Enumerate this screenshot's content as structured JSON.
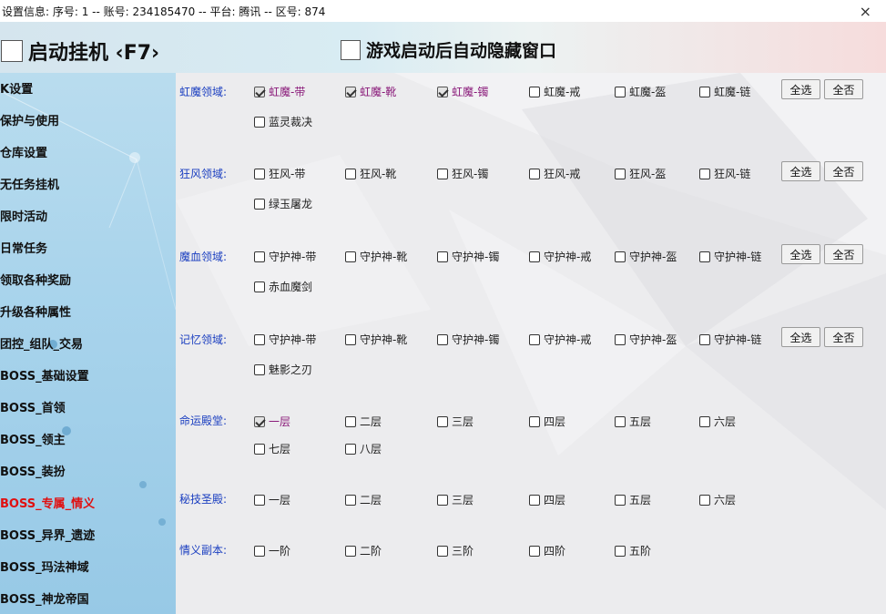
{
  "titlebar": {
    "info": "设置信息:    序号: 1  --  账号: 234185470  --  平台: 腾讯  --  区号: 874",
    "close": "×"
  },
  "topbar": {
    "hang_label": "启动挂机 ‹F7›",
    "autohide_label": "游戏启动后自动隐藏窗口"
  },
  "sidebar": {
    "items": [
      {
        "label": "K设置"
      },
      {
        "label": "保护与使用"
      },
      {
        "label": "仓库设置"
      },
      {
        "label": "无任务挂机"
      },
      {
        "label": "限时活动"
      },
      {
        "label": "日常任务"
      },
      {
        "label": "领取各种奖励"
      },
      {
        "label": "升级各种属性"
      },
      {
        "label": "团控_组队_交易"
      },
      {
        "label": "BOSS_基础设置"
      },
      {
        "label": "BOSS_首领"
      },
      {
        "label": "BOSS_领主"
      },
      {
        "label": "BOSS_装扮"
      },
      {
        "label": "BOSS_专属_情义",
        "active": true
      },
      {
        "label": "BOSS_异界_遗迹"
      },
      {
        "label": "BOSS_玛法神域"
      },
      {
        "label": "BOSS_神龙帝国"
      }
    ]
  },
  "main": {
    "buttons": {
      "select_all": "全选",
      "select_none": "全否"
    },
    "groups": [
      {
        "label": "虹魔领域:",
        "items": [
          {
            "label": "虹魔-带",
            "checked": true
          },
          {
            "label": "虹魔-靴",
            "checked": true
          },
          {
            "label": "虹魔-镯",
            "checked": true
          },
          {
            "label": "虹魔-戒",
            "checked": false
          },
          {
            "label": "虹魔-盔",
            "checked": false
          },
          {
            "label": "虹魔-链",
            "checked": false
          },
          {
            "label": "蓝灵裁决",
            "checked": false
          }
        ]
      },
      {
        "label": "狂风领域:",
        "items": [
          {
            "label": "狂风-带",
            "checked": false
          },
          {
            "label": "狂风-靴",
            "checked": false
          },
          {
            "label": "狂风-镯",
            "checked": false
          },
          {
            "label": "狂风-戒",
            "checked": false
          },
          {
            "label": "狂风-盔",
            "checked": false
          },
          {
            "label": "狂风-链",
            "checked": false
          },
          {
            "label": "绿玉屠龙",
            "checked": false
          }
        ]
      },
      {
        "label": "魔血领域:",
        "items": [
          {
            "label": "守护神-带",
            "checked": false
          },
          {
            "label": "守护神-靴",
            "checked": false
          },
          {
            "label": "守护神-镯",
            "checked": false
          },
          {
            "label": "守护神-戒",
            "checked": false
          },
          {
            "label": "守护神-盔",
            "checked": false
          },
          {
            "label": "守护神-链",
            "checked": false
          },
          {
            "label": "赤血魔剑",
            "checked": false
          }
        ]
      },
      {
        "label": "记忆领域:",
        "items": [
          {
            "label": "守护神-带",
            "checked": false
          },
          {
            "label": "守护神-靴",
            "checked": false
          },
          {
            "label": "守护神-镯",
            "checked": false
          },
          {
            "label": "守护神-戒",
            "checked": false
          },
          {
            "label": "守护神-盔",
            "checked": false
          },
          {
            "label": "守护神-链",
            "checked": false
          },
          {
            "label": "魅影之刃",
            "checked": false
          }
        ]
      }
    ],
    "fate_hall": {
      "label": "命运殿堂:",
      "items": [
        {
          "label": "一层",
          "checked": true
        },
        {
          "label": "二层",
          "checked": false
        },
        {
          "label": "三层",
          "checked": false
        },
        {
          "label": "四层",
          "checked": false
        },
        {
          "label": "五层",
          "checked": false
        },
        {
          "label": "六层",
          "checked": false
        },
        {
          "label": "七层",
          "checked": false
        },
        {
          "label": "八层",
          "checked": false
        }
      ]
    },
    "secret_hall": {
      "label": "秘技圣殿:",
      "items": [
        {
          "label": "一层",
          "checked": false
        },
        {
          "label": "二层",
          "checked": false
        },
        {
          "label": "三层",
          "checked": false
        },
        {
          "label": "四层",
          "checked": false
        },
        {
          "label": "五层",
          "checked": false
        },
        {
          "label": "六层",
          "checked": false
        }
      ]
    },
    "bond_dungeon": {
      "label": "情义副本:",
      "items": [
        {
          "label": "一阶",
          "checked": false
        },
        {
          "label": "二阶",
          "checked": false
        },
        {
          "label": "三阶",
          "checked": false
        },
        {
          "label": "四阶",
          "checked": false
        },
        {
          "label": "五阶",
          "checked": false
        }
      ]
    }
  }
}
